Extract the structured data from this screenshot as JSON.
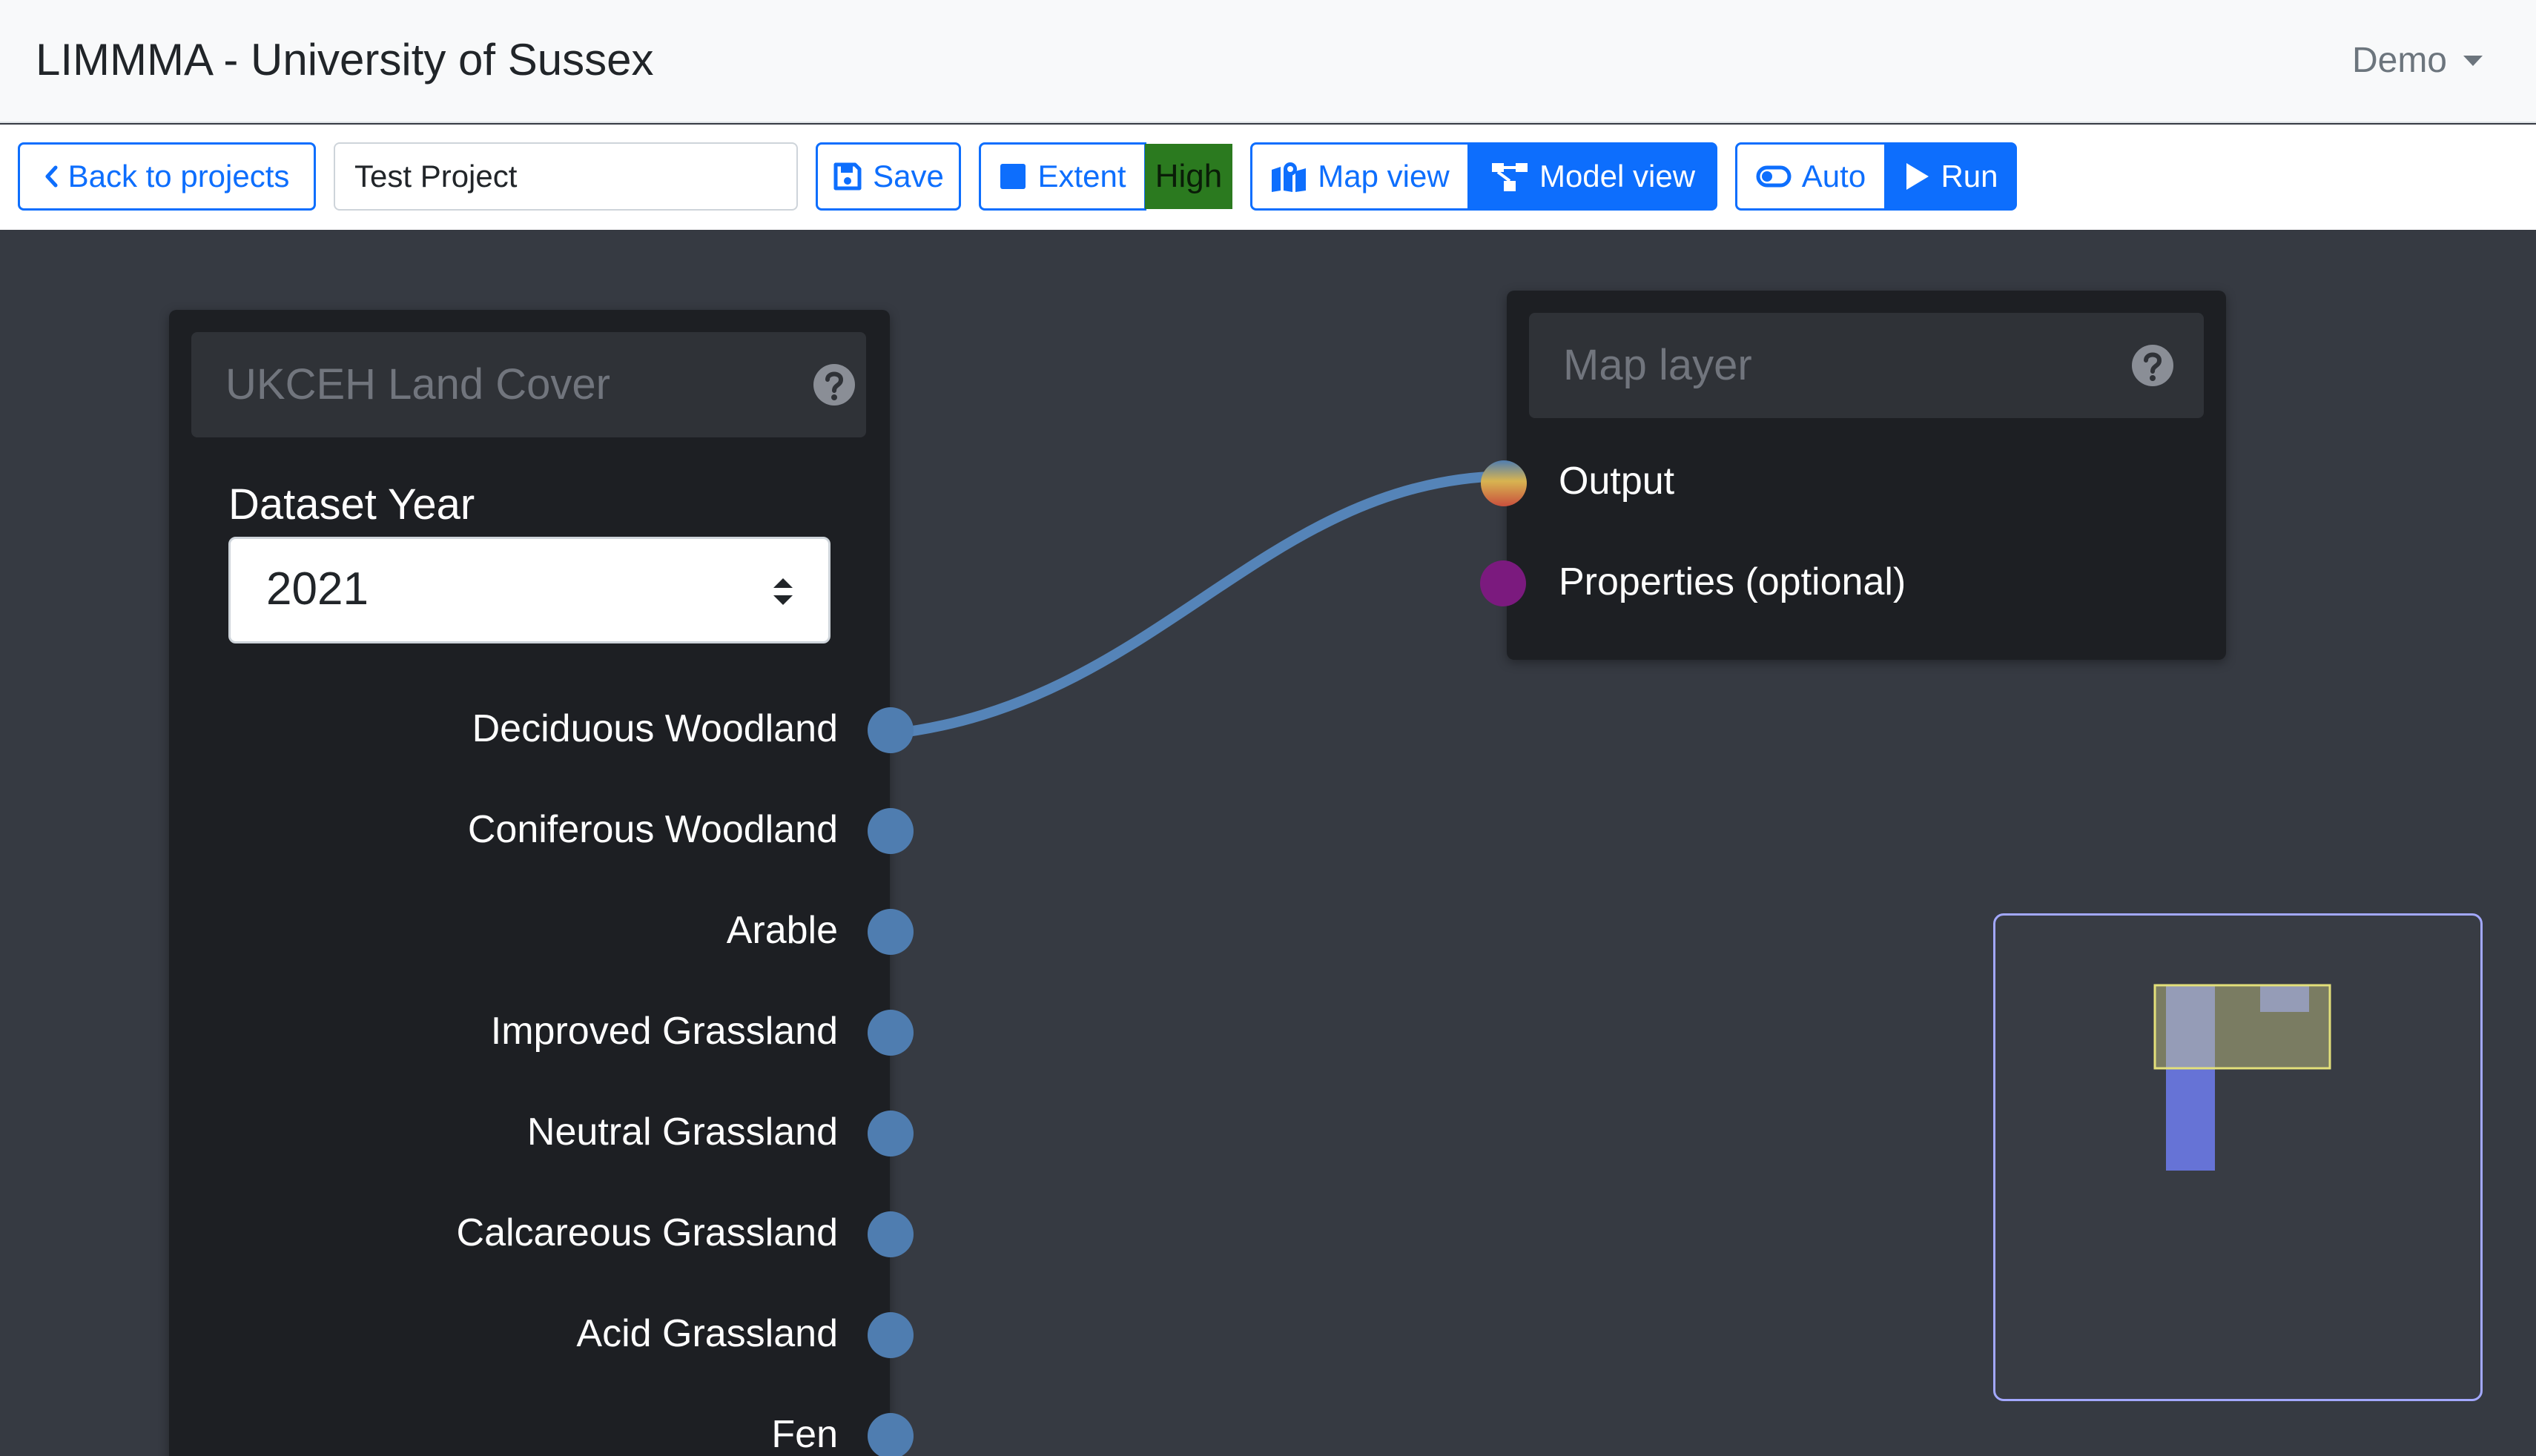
{
  "app": {
    "title": "LIMMMA - University of Sussex",
    "user_menu_label": "Demo"
  },
  "toolbar": {
    "back_label": "Back to projects",
    "project_name": "Test Project",
    "save_label": "Save",
    "extent_label": "Extent",
    "resolution_badge": "High",
    "map_view_label": "Map view",
    "model_view_label": "Model view",
    "auto_label": "Auto",
    "run_label": "Run",
    "active_view": "Model view"
  },
  "colors": {
    "accent": "#0d6efd",
    "high_badge": "#2b7a1f",
    "socket_land_cover": "#4f7db0",
    "socket_properties": "#7b1a7e",
    "connection": "#5584b8",
    "canvas_bg": "#363a42",
    "node_bg": "#1d1f23"
  },
  "nodes": {
    "land_cover": {
      "title": "UKCEH Land Cover",
      "field_label": "Dataset Year",
      "dataset_year": "2021",
      "outputs": [
        "Deciduous Woodland",
        "Coniferous Woodland",
        "Arable",
        "Improved Grassland",
        "Neutral Grassland",
        "Calcareous Grassland",
        "Acid Grassland",
        "Fen"
      ]
    },
    "map_layer": {
      "title": "Map layer",
      "inputs": [
        "Output",
        "Properties (optional)"
      ]
    }
  },
  "icons": {
    "back": "chevron-left-icon",
    "save": "floppy-disk-icon",
    "extent": "square-icon",
    "map_view": "map-location-icon",
    "model_view": "diagram-nodes-icon",
    "auto": "toggle-icon",
    "run": "play-icon",
    "help": "question-circle-icon",
    "select": "sort-arrows-icon"
  }
}
